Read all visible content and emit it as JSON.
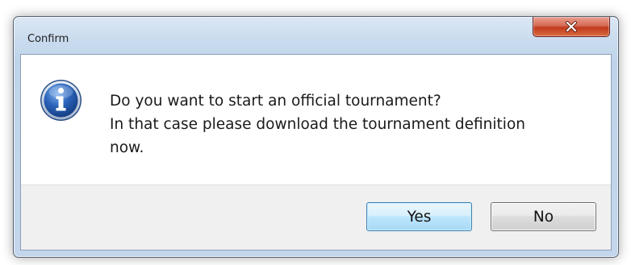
{
  "window": {
    "title": "Confirm"
  },
  "dialog": {
    "icon": "info-icon",
    "message_lines": [
      "Do you want to start an official tournament?",
      "In that case please download the tournament definition",
      "now."
    ]
  },
  "buttons": {
    "yes_label": "Yes",
    "no_label": "No",
    "default": "Yes"
  },
  "colors": {
    "close_button": "#c9452a",
    "info_icon": "#2a62b8",
    "default_button_border": "#3c7fb1"
  }
}
